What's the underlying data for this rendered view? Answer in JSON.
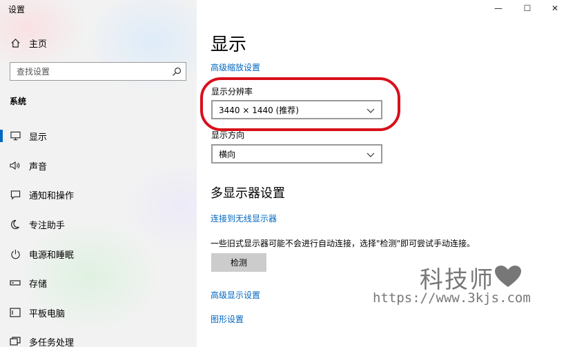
{
  "window": {
    "title": "设置",
    "minimize": "—",
    "maximize": "☐",
    "close": "✕"
  },
  "sidebar": {
    "home_label": "主页",
    "search_placeholder": "查找设置",
    "section": "系统",
    "items": [
      {
        "label": "显示",
        "icon": "monitor-icon"
      },
      {
        "label": "声音",
        "icon": "speaker-icon"
      },
      {
        "label": "通知和操作",
        "icon": "message-icon"
      },
      {
        "label": "专注助手",
        "icon": "moon-icon"
      },
      {
        "label": "电源和睡眠",
        "icon": "power-icon"
      },
      {
        "label": "存储",
        "icon": "drive-icon"
      },
      {
        "label": "平板电脑",
        "icon": "tablet-icon"
      },
      {
        "label": "多任务处理",
        "icon": "multitask-icon"
      }
    ]
  },
  "main": {
    "title": "显示",
    "advanced_scaling_link": "高级缩放设置",
    "resolution_label": "显示分辨率",
    "resolution_value": "3440 × 1440 (推荐)",
    "orientation_label": "显示方向",
    "orientation_value": "横向",
    "multi_display_title": "多显示器设置",
    "wireless_link": "连接到无线显示器",
    "detect_description": "一些旧式显示器可能不会进行自动连接，选择\"检测\"即可尝试手动连接。",
    "detect_button": "检测",
    "advanced_display_link": "高级显示设置",
    "graphics_link": "图形设置"
  },
  "watermark": {
    "text": "科技师",
    "url": "https://www.3kjs.com"
  },
  "colors": {
    "accent": "#0067c0",
    "highlight_ring": "#d8101a"
  }
}
